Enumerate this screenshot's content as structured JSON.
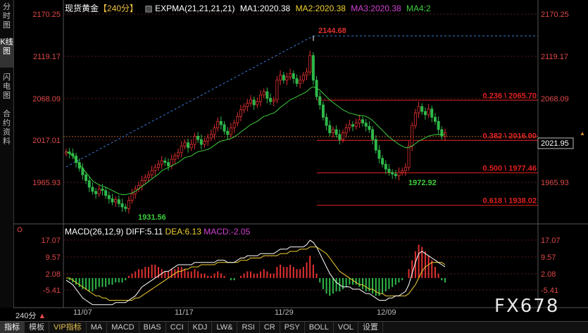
{
  "left_tabs": [
    "分时图",
    "K线图",
    "闪电图",
    "合约资料"
  ],
  "header": {
    "symbol": "现货黄金",
    "period_tag": "【240分】",
    "indicator": "EXPMA(21,21,21,21)",
    "ma1": "MA1:2020.38",
    "ma2": "MA2:2020.38",
    "ma3": "MA3:2020.38",
    "ma4": "MA4:2"
  },
  "macd_header": {
    "name": "MACD(26,12,9)",
    "diff": "DIFF:5.11",
    "dea": "DEA:6.13",
    "macd": "MACD:-2.05"
  },
  "price_axis_labels": [
    "2170.25",
    "2119.17",
    "2068.09",
    "2017.01",
    "1965.93"
  ],
  "macd_axis_labels": [
    "17.07",
    "9.57",
    "2.08",
    "-5.41"
  ],
  "current_price": "2021.95",
  "annotations": {
    "high": "2144.68",
    "low1": "1931.56",
    "low2": "1972.92"
  },
  "fib_levels": [
    {
      "label": "0.236 \\ 2065.70",
      "value": 2065.7
    },
    {
      "label": "0.382 \\ 2016.90",
      "value": 2016.9
    },
    {
      "label": "0.500 \\ 1977.46",
      "value": 1977.46
    },
    {
      "label": "0.618 \\ 1938.02",
      "value": 1938.02
    }
  ],
  "x_labels": [
    "11/07",
    "11/17",
    "11/29",
    "12/09"
  ],
  "period_selector": "240分",
  "bottom_tabs": [
    "指标",
    "模板",
    "VIP指标",
    "MA",
    "MACD",
    "BIAS",
    "CCI",
    "KDJ",
    "LW&",
    "RSI",
    "CR",
    "PSY",
    "BOLL",
    "VOL",
    "设置"
  ],
  "watermark": "FX678",
  "colors": {
    "up": "#e03030",
    "down": "#2fb84a",
    "ma": "#3ccf3c",
    "diff": "#ffffff",
    "dea": "#f0d030",
    "fib": "#e02020",
    "trend": "#3a7bd5"
  },
  "chart_data": {
    "type": "candlestick",
    "title": "现货黄金 240分",
    "ylim": [
      1925,
      2178
    ],
    "x_ticks": [
      "11/07",
      "11/17",
      "11/29",
      "12/09"
    ],
    "close_series": [
      2003,
      2001,
      1998,
      1990,
      1983,
      1975,
      1968,
      1960,
      1955,
      1952,
      1958,
      1956,
      1950,
      1946,
      1942,
      1945,
      1940,
      1936,
      1934,
      1944,
      1952,
      1958,
      1962,
      1968,
      1972,
      1975,
      1980,
      1984,
      1988,
      1992,
      1990,
      1986,
      1994,
      1998,
      2002,
      2010,
      2014,
      2008,
      2012,
      2022,
      2018,
      2012,
      2016,
      2020,
      2024,
      2032,
      2040,
      2036,
      2028,
      2024,
      2032,
      2038,
      2046,
      2054,
      2058,
      2062,
      2066,
      2060,
      2064,
      2072,
      2076,
      2068,
      2064,
      2066,
      2090,
      2096,
      2090,
      2094,
      2098,
      2092,
      2086,
      2090,
      2096,
      2100,
      2120,
      2090,
      2070,
      2060,
      2045,
      2035,
      2026,
      2030,
      2024,
      2018,
      2026,
      2032,
      2036,
      2034,
      2038,
      2042,
      2038,
      2034,
      2030,
      2018,
      2005,
      1995,
      1988,
      1982,
      1978,
      1976,
      1974,
      1978,
      1980,
      1984,
      2010,
      2035,
      2050,
      2058,
      2052,
      2048,
      2055,
      2045,
      2040,
      2030,
      2022,
      2026
    ],
    "ema_series": [
      2003,
      2001,
      1998,
      1993,
      1988,
      1983,
      1978,
      1973,
      1968,
      1965,
      1963,
      1961,
      1960,
      1958,
      1956,
      1954,
      1952,
      1951,
      1951,
      1952,
      1953,
      1955,
      1958,
      1961,
      1964,
      1967,
      1970,
      1973,
      1976,
      1980,
      1982,
      1984,
      1986,
      1988,
      1990,
      1993,
      1996,
      1997,
      1998,
      2001,
      2003,
      2004,
      2005,
      2006,
      2008,
      2011,
      2014,
      2016,
      2017,
      2018,
      2019,
      2021,
      2024,
      2027,
      2030,
      2033,
      2036,
      2038,
      2040,
      2043,
      2046,
      2047,
      2049,
      2050,
      2053,
      2057,
      2060,
      2063,
      2066,
      2068,
      2070,
      2072,
      2074,
      2076,
      2080,
      2082,
      2080,
      2078,
      2074,
      2070,
      2066,
      2063,
      2060,
      2057,
      2054,
      2052,
      2050,
      2049,
      2048,
      2047,
      2047,
      2046,
      2044,
      2041,
      2037,
      2033,
      2029,
      2025,
      2021,
      2018,
      2015,
      2012,
      2010,
      2008,
      2008,
      2010,
      2013,
      2016,
      2018,
      2020,
      2022,
      2023,
      2024,
      2024,
      2024,
      2024
    ],
    "macd_hist": [
      0,
      -1,
      -2,
      -3,
      -4,
      -5,
      -5,
      -6,
      -6,
      -5,
      -4,
      -4,
      -4,
      -3,
      -3,
      -2,
      -2,
      -2,
      -1,
      1,
      2,
      3,
      4,
      4,
      5,
      5,
      6,
      6,
      5,
      4,
      3,
      3,
      4,
      4,
      5,
      5,
      4,
      3,
      3,
      4,
      3,
      2,
      2,
      1,
      1,
      2,
      3,
      2,
      1,
      0,
      -1,
      -1,
      0,
      1,
      2,
      3,
      3,
      2,
      2,
      3,
      4,
      3,
      2,
      2,
      5,
      6,
      5,
      5,
      6,
      5,
      4,
      4,
      5,
      7,
      10,
      6,
      2,
      -2,
      -5,
      -7,
      -8,
      -7,
      -6,
      -6,
      -5,
      -4,
      -3,
      -3,
      -3,
      -4,
      -5,
      -6,
      -6,
      -7,
      -8,
      -8,
      -7,
      -6,
      -5,
      -4,
      -3,
      -2,
      -1,
      0,
      4,
      8,
      12,
      15,
      14,
      12,
      10,
      8,
      5,
      2,
      -1,
      -2
    ],
    "diff_series": [
      -1,
      -2,
      -3,
      -5,
      -7,
      -9,
      -10,
      -11,
      -12,
      -12,
      -12,
      -12,
      -12,
      -12,
      -12,
      -11,
      -11,
      -11,
      -11,
      -10,
      -9,
      -8,
      -6,
      -4,
      -3,
      -2,
      -1,
      0,
      1,
      2,
      3,
      3,
      4,
      5,
      6,
      6,
      6,
      6,
      6,
      7,
      7,
      7,
      7,
      7,
      7,
      7,
      8,
      8,
      8,
      7,
      7,
      7,
      8,
      9,
      9,
      10,
      10,
      10,
      10,
      11,
      11,
      11,
      11,
      11,
      12,
      13,
      13,
      13,
      14,
      14,
      14,
      14,
      14,
      15,
      17,
      16,
      14,
      11,
      8,
      5,
      2,
      0,
      -2,
      -3,
      -4,
      -4,
      -4,
      -5,
      -5,
      -5,
      -6,
      -7,
      -7,
      -8,
      -9,
      -10,
      -10,
      -10,
      -9,
      -9,
      -8,
      -8,
      -7,
      -6,
      -3,
      2,
      7,
      11,
      12,
      11,
      10,
      9,
      8,
      7,
      6,
      5
    ],
    "dea_series": [
      0,
      0,
      -1,
      -2,
      -3,
      -4,
      -5,
      -6,
      -7,
      -8,
      -8,
      -9,
      -9,
      -10,
      -10,
      -10,
      -10,
      -10,
      -10,
      -10,
      -10,
      -9,
      -9,
      -8,
      -7,
      -6,
      -5,
      -4,
      -3,
      -2,
      -1,
      0,
      1,
      2,
      3,
      3,
      4,
      4,
      5,
      5,
      5,
      6,
      6,
      6,
      6,
      6,
      7,
      7,
      7,
      7,
      7,
      7,
      7,
      8,
      8,
      8,
      9,
      9,
      9,
      9,
      10,
      10,
      10,
      10,
      10,
      11,
      11,
      11,
      12,
      12,
      12,
      13,
      13,
      13,
      14,
      14,
      14,
      13,
      12,
      11,
      9,
      7,
      5,
      3,
      2,
      1,
      0,
      -1,
      -2,
      -3,
      -3,
      -4,
      -5,
      -5,
      -6,
      -7,
      -7,
      -8,
      -8,
      -8,
      -8,
      -8,
      -8,
      -8,
      -7,
      -5,
      -3,
      0,
      3,
      5,
      6,
      7,
      7,
      7,
      7,
      6
    ]
  }
}
